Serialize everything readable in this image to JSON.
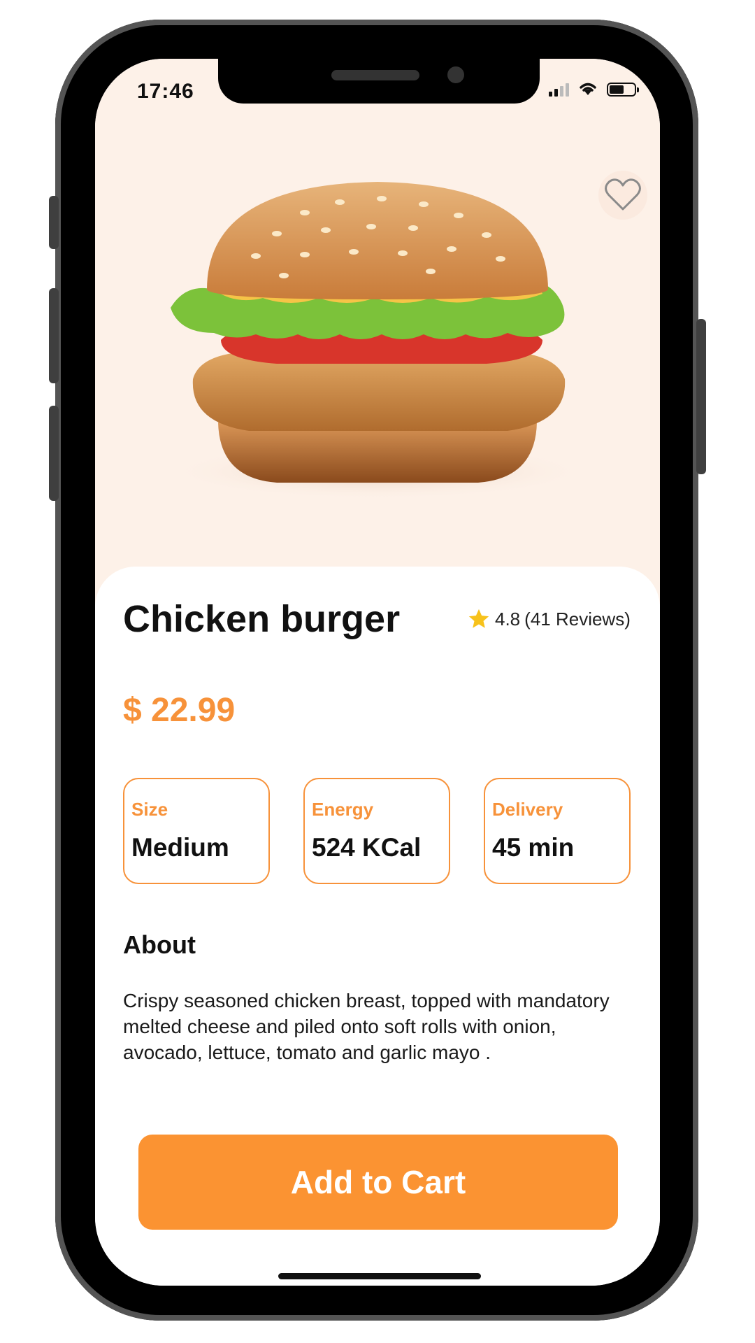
{
  "status_bar": {
    "time": "17:46"
  },
  "product": {
    "name": "Chicken burger",
    "rating": "4.8",
    "reviews": "(41 Reviews)",
    "price": "$ 22.99"
  },
  "specs": [
    {
      "label": "Size",
      "value": "Medium"
    },
    {
      "label": "Energy",
      "value": "524 KCal"
    },
    {
      "label": "Delivery",
      "value": "45 min"
    }
  ],
  "about": {
    "heading": "About",
    "text": "Crispy seasoned chicken breast, topped with mandatory melted cheese and piled onto soft rolls with onion, avocado, lettuce, tomato and garlic mayo ."
  },
  "cta": {
    "label": "Add to Cart"
  },
  "icons": [
    "heart-icon",
    "star-icon",
    "signal-icon",
    "wifi-icon",
    "battery-icon"
  ],
  "colors": {
    "accent": "#f7923a",
    "button": "#fb9332",
    "hero_bg": "#fdf1e8",
    "star": "#f7c21b"
  }
}
